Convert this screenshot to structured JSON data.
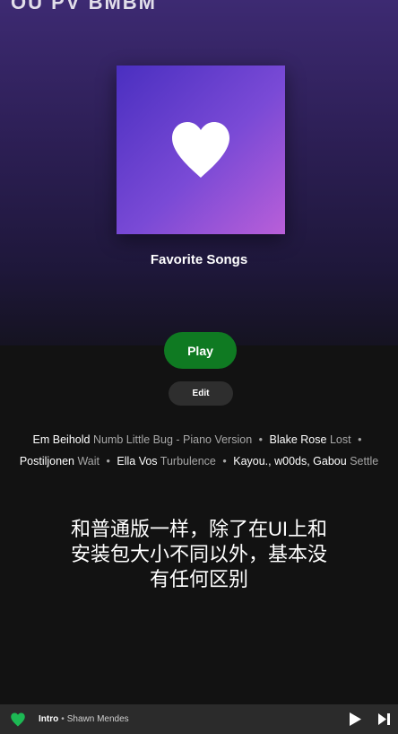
{
  "header": {
    "top_text": "OU PV BMBM"
  },
  "playlist": {
    "title": "Favorite Songs",
    "cover_icon": "heart-icon",
    "cover_colors": [
      "#4a2fc0",
      "#7a4ad6",
      "#b95fd8"
    ]
  },
  "actions": {
    "play_label": "Play",
    "edit_label": "Edit"
  },
  "tracks": [
    {
      "artist": "Em Beihold",
      "title": "Numb Little Bug - Piano Version"
    },
    {
      "artist": "Blake Rose",
      "title": "Lost"
    },
    {
      "artist": "Postiljonen",
      "title": "Wait"
    },
    {
      "artist": "Ella Vos",
      "title": "Turbulence"
    },
    {
      "artist": "Kayou., w00ds, Gabou",
      "title": "Settle"
    }
  ],
  "caption": "和普通版一样，除了在UI上和\n安装包大小不同以外，基本没\n有任何区别",
  "now_playing": {
    "track": "Intro",
    "separator": "•",
    "artist": "Shawn Mendes",
    "liked_icon": "heart-filled-icon",
    "play_icon": "play-icon",
    "next_icon": "skip-next-icon"
  },
  "colors": {
    "accent": "#1db954",
    "play_button": "#0f7a22",
    "background": "#121212",
    "header_gradient": "#3d2a72"
  }
}
